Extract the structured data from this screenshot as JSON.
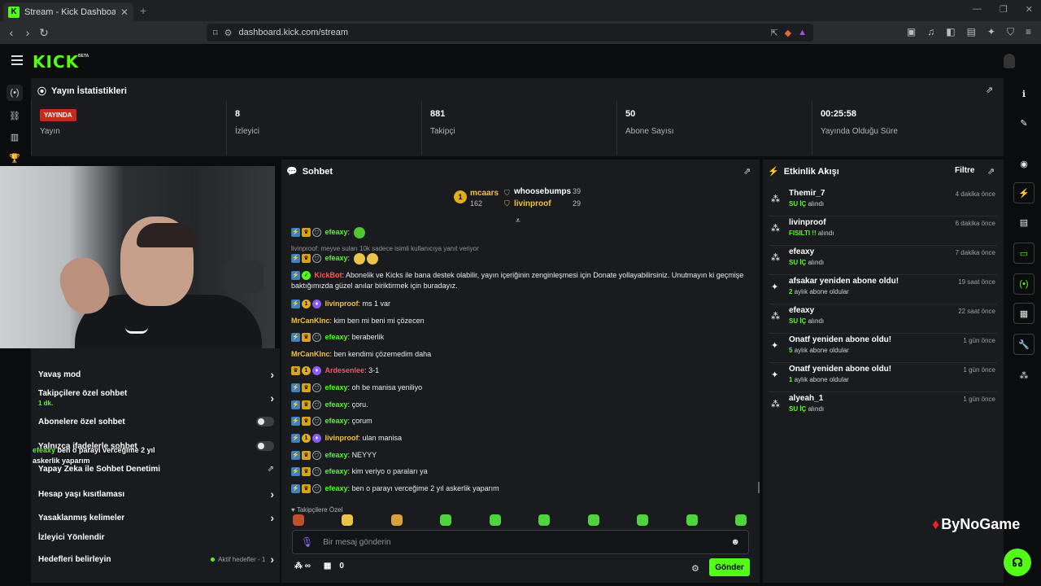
{
  "browser": {
    "tab_title": "Stream - Kick Dashboard",
    "url": "dashboard.kick.com/stream"
  },
  "brand": {
    "logo": "KICK",
    "beta": "BETA",
    "accent": "#53fc18"
  },
  "stats": {
    "title": "Yayın İstatistikleri",
    "live_badge": "YAYINDA",
    "cells": [
      {
        "label": "Yayın"
      },
      {
        "value": "8",
        "label": "İzleyici"
      },
      {
        "value": "881",
        "label": "Takipçi"
      },
      {
        "value": "50",
        "label": "Abone Sayısı"
      },
      {
        "value": "00:25:58",
        "label": "Yayında Olduğu Süre"
      }
    ]
  },
  "settings": {
    "rows": [
      {
        "label": "Yavaş mod"
      },
      {
        "label": "Takipçilere özel sohbet",
        "sub": "1 dk."
      },
      {
        "label": "Abonelere özel sohbet"
      },
      {
        "label": "Yalnızca ifadelerle sohbet"
      },
      {
        "label": "Yapay Zeka ile Sohbet Denetimi"
      },
      {
        "label": "Hesap yaşı kısıtlaması"
      },
      {
        "label": "Yasaklanmış kelimeler"
      },
      {
        "label": "İzleyici Yönlendir"
      },
      {
        "label": "Hedefleri belirleyin",
        "extra": "Aktif hedefler - 1"
      }
    ],
    "overlay": {
      "user": "efeaxy",
      "text": "ben o parayı verceğime 2 yıl askerlik yaparım"
    }
  },
  "chat": {
    "title": "Sohbet",
    "gifters": [
      {
        "rank": "1",
        "name": "mcaars",
        "count": "162"
      },
      {
        "name": "whoosebumps",
        "count": "39"
      },
      {
        "name": "livinproof",
        "count": "29"
      }
    ],
    "reply_line": "livinproof: meyve suları 10k sadece isimli kullanıcıya yanıt veriyor",
    "kickbot_text": "Abonelik ve Kicks ile bana destek olabilir, yayın içeriğinin zenginleşmesi için Donate yollayabilirsiniz. Unutmayın ki geçmişe baktığımızda güzel anılar biriktirmek için buradayız.",
    "messages": [
      {
        "user": "efeaxy",
        "text": ""
      },
      {
        "user": "efeaxy",
        "text": ""
      },
      {
        "user": "KickBot",
        "text": ""
      },
      {
        "user": "livinproof",
        "text": "ms 1 var"
      },
      {
        "user": "MrCanKInc",
        "text": "kim ben mi beni mi çözecen"
      },
      {
        "user": "efeaxy",
        "text": "beraberlik"
      },
      {
        "user": "MrCanKInc",
        "text": "ben kendimi çözemedim daha"
      },
      {
        "user": "Ardesenlee",
        "text": "3-1"
      },
      {
        "user": "efeaxy",
        "text": "oh be manisa yeniliyo"
      },
      {
        "user": "efeaxy",
        "text": "çoru."
      },
      {
        "user": "efeaxy",
        "text": "çorum"
      },
      {
        "user": "livinproof",
        "text": "ulan manisa"
      },
      {
        "user": "efeaxy",
        "text": "NEYYY"
      },
      {
        "user": "efeaxy",
        "text": "kim veriyo o paraları ya"
      },
      {
        "user": "efeaxy",
        "text": "ben o parayı verceğime 2 yıl askerlik yaparım"
      }
    ],
    "emote_label": "Takipçilere Özel",
    "input_placeholder": "Bir mesaj gönderin",
    "kicks": "0",
    "send_label": "Gönder"
  },
  "activity": {
    "title": "Etkinlik Akışı",
    "filter": "Filtre",
    "items": [
      {
        "name": "Themir_7",
        "hl": "SU İÇ",
        "rest": " alındı",
        "time": "4 dakika önce"
      },
      {
        "name": "livinproof",
        "hl": "FISILTI !!",
        "rest": " alındı",
        "time": "6 dakika önce"
      },
      {
        "name": "efeaxy",
        "hl": "SU İÇ",
        "rest": " alındı",
        "time": "7 dakika önce"
      },
      {
        "name": "afsakar yeniden abone oldu!",
        "hl": "2",
        "rest": " aylık abone oldular",
        "time": "19 saat önce"
      },
      {
        "name": "efeaxy",
        "hl": "SU İÇ",
        "rest": " alındı",
        "time": "22 saat önce"
      },
      {
        "name": "Onatf yeniden abone oldu!",
        "hl": "5",
        "rest": " aylık abone oldular",
        "time": "1 gün önce"
      },
      {
        "name": "Onatf yeniden abone oldu!",
        "hl": "1",
        "rest": " aylık abone oldular",
        "time": "1 gün önce"
      },
      {
        "name": "alyeah_1",
        "hl": "SU İÇ",
        "rest": " alındı",
        "time": "1 gün önce"
      }
    ]
  },
  "watermark": "ByNoGame"
}
